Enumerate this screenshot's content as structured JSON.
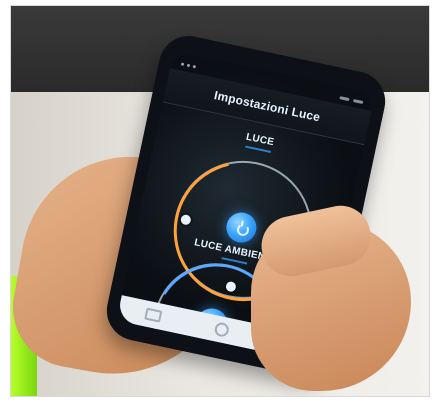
{
  "app": {
    "title": "Impostazioni Luce"
  },
  "sections": {
    "luce": {
      "title": "LUCE"
    },
    "luce_ambiente": {
      "title": "LUCE AMBIENTE"
    }
  },
  "icons": {
    "power": "power-icon",
    "nav_recent": "recent-apps-icon",
    "nav_home": "home-icon",
    "nav_back": "back-icon"
  },
  "colors": {
    "accent_orange": "#ffa23a",
    "accent_blue": "#3aa6ff",
    "ui_dark": "#0b0f14"
  }
}
